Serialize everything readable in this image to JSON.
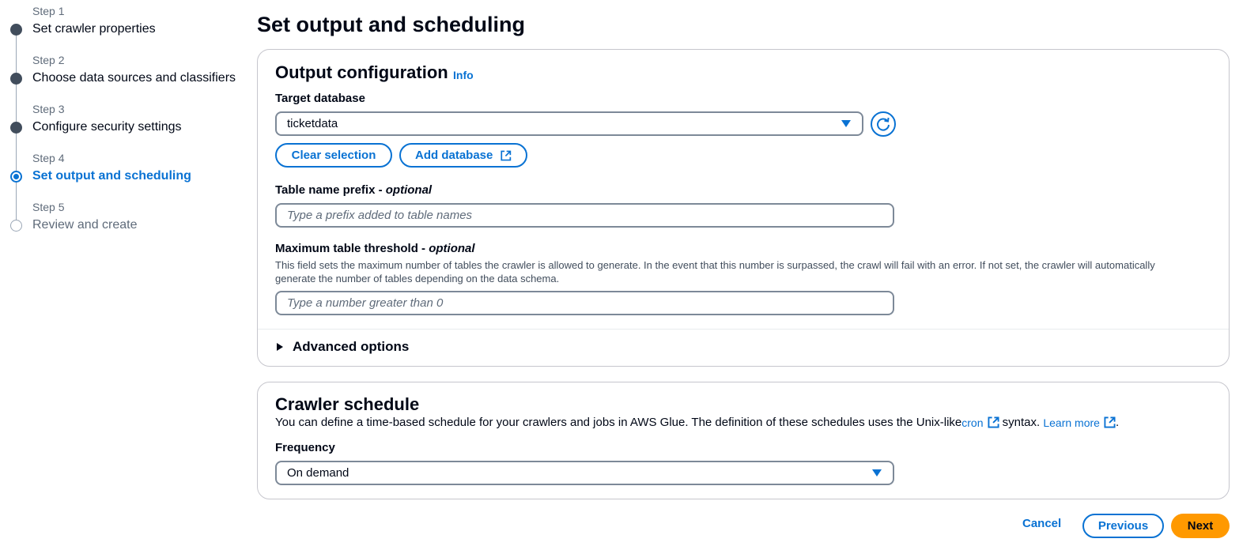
{
  "steps": [
    {
      "num": "Step 1",
      "label": "Set crawler properties",
      "state": "done"
    },
    {
      "num": "Step 2",
      "label": "Choose data sources and classifiers",
      "state": "done"
    },
    {
      "num": "Step 3",
      "label": "Configure security settings",
      "state": "done"
    },
    {
      "num": "Step 4",
      "label": "Set output and scheduling",
      "state": "active"
    },
    {
      "num": "Step 5",
      "label": "Review and create",
      "state": "future"
    }
  ],
  "page_title": "Set output and scheduling",
  "output": {
    "heading": "Output configuration",
    "info_link": "Info",
    "target_db_label": "Target database",
    "target_db_value": "ticketdata",
    "clear_button": "Clear selection",
    "add_db_button": "Add database",
    "prefix_label": "Table name prefix - ",
    "prefix_optional": "optional",
    "prefix_placeholder": "Type a prefix added to table names",
    "threshold_label": "Maximum table threshold - ",
    "threshold_optional": "optional",
    "threshold_desc": "This field sets the maximum number of tables the crawler is allowed to generate. In the event that this number is surpassed, the crawl will fail with an error. If not set, the crawler will automatically generate the number of tables depending on the data schema.",
    "threshold_placeholder": "Type a number greater than 0",
    "advanced": "Advanced options"
  },
  "schedule": {
    "heading": "Crawler schedule",
    "desc_before": "You can define a time-based schedule for your crawlers and jobs in AWS Glue. The definition of these schedules uses the Unix-like ",
    "cron_link": "cron",
    "desc_after": " syntax. ",
    "learn_more": "Learn more",
    "period": ".",
    "frequency_label": "Frequency",
    "frequency_value": "On demand"
  },
  "footer": {
    "cancel": "Cancel",
    "previous": "Previous",
    "next": "Next"
  },
  "colors": {
    "accent": "#0972d3",
    "primary_button": "#ff9900",
    "text": "#000716"
  }
}
